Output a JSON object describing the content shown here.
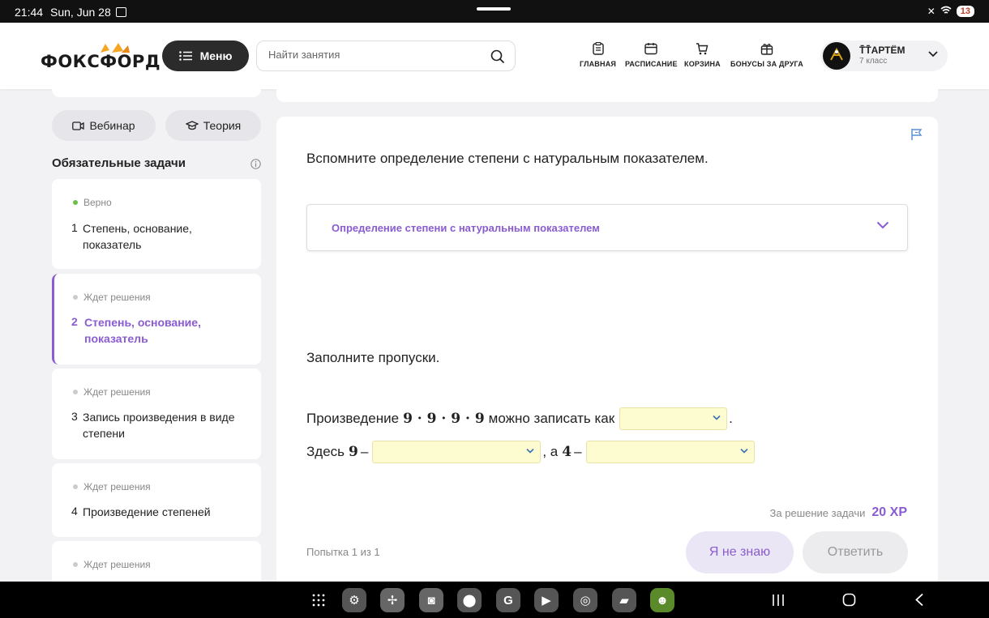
{
  "status_bar": {
    "time": "21:44",
    "date": "Sun, Jun 28",
    "battery": "13"
  },
  "header": {
    "logo": "ФОКСФОРД",
    "menu_label": "Меню",
    "search_placeholder": "Найти занятия",
    "nav": [
      {
        "label": "ГЛАВНАЯ",
        "icon": "clipboard-icon"
      },
      {
        "label": "РАСПИСАНИЕ",
        "icon": "calendar-icon"
      },
      {
        "label": "КОРЗИНА",
        "icon": "cart-icon"
      },
      {
        "label": "БОНУСЫ ЗА ДРУГА",
        "icon": "gift-icon"
      }
    ],
    "user": {
      "name": "Ṫ̈Ṫ̈АРТЁМ",
      "grade": "7 класс"
    }
  },
  "sidebar": {
    "chips": [
      {
        "label": "Вебинар",
        "icon": "video-icon"
      },
      {
        "label": "Теория",
        "icon": "graduation-cap-icon"
      }
    ],
    "title": "Обязательные задачи",
    "tasks": [
      {
        "status": "Верно",
        "num": "1",
        "name": "Степень, основание, показатель"
      },
      {
        "status": "Ждет решения",
        "num": "2",
        "name": "Степень, основание, показатель"
      },
      {
        "status": "Ждет решения",
        "num": "3",
        "name": "Запись произведения в виде степени"
      },
      {
        "status": "Ждет решения",
        "num": "4",
        "name": "Произведение степеней"
      },
      {
        "status": "Ждет решения",
        "num": "",
        "name": ""
      }
    ]
  },
  "main": {
    "question1": "Вспомните определение степени с натуральным показателем.",
    "accordion_label": "Определение степени с натуральным показателем",
    "question2": "Заполните пропуски.",
    "line1_prefix": "Произведение",
    "line1_math": "9 · 9 · 9 · 9",
    "line1_suffix": "можно записать как",
    "line1_end": ".",
    "line2_prefix": "Здесь",
    "line2_math1": "9",
    "dash": "–",
    "line2_mid": ", а",
    "line2_math2": "4",
    "reward_label": "За решение задачи",
    "reward_value": "20 XP",
    "attempt": "Попытка 1 из 1",
    "dunno_label": "Я не знаю",
    "answer_label": "Ответить"
  },
  "colors": {
    "accent": "#8a5cd1",
    "select_bg": "#fdfbd0",
    "ok": "#6bbf4a"
  }
}
